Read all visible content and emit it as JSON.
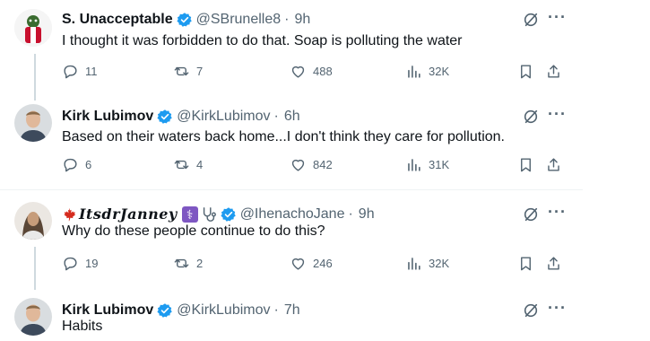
{
  "posts": [
    {
      "name": "S. Unacceptable",
      "handle": "@SBrunelle8",
      "time": "9h",
      "text": "I thought it was forbidden to do that. Soap is polluting the water",
      "replies": "11",
      "reposts": "7",
      "likes": "488",
      "views": "32K"
    },
    {
      "name": "Kirk Lubimov",
      "handle": "@KirkLubimov",
      "time": "6h",
      "text": "Based on their waters back home...I don't think they care for pollution.",
      "replies": "6",
      "reposts": "4",
      "likes": "842",
      "views": "31K"
    },
    {
      "name": "ItsdrJanney",
      "handle": "@IhenachoJane",
      "time": "9h",
      "text": "Why do these people continue to do this?",
      "replies": "19",
      "reposts": "2",
      "likes": "246",
      "views": "32K",
      "name_emojis": [
        "maple-leaf",
        "medical-symbol",
        "stethoscope"
      ]
    },
    {
      "name": "Kirk Lubimov",
      "handle": "@KirkLubimov",
      "time": "7h",
      "text": "Habits"
    }
  ],
  "colors": {
    "verified": "#1d9bf0",
    "text": "#0f1419",
    "secondary": "#536471",
    "thread_line": "#cfd9de"
  },
  "icons": [
    "reply-icon",
    "repost-icon",
    "like-icon",
    "views-icon",
    "bookmark-icon",
    "share-icon",
    "grok-icon",
    "more-icon",
    "verified-badge-icon"
  ]
}
